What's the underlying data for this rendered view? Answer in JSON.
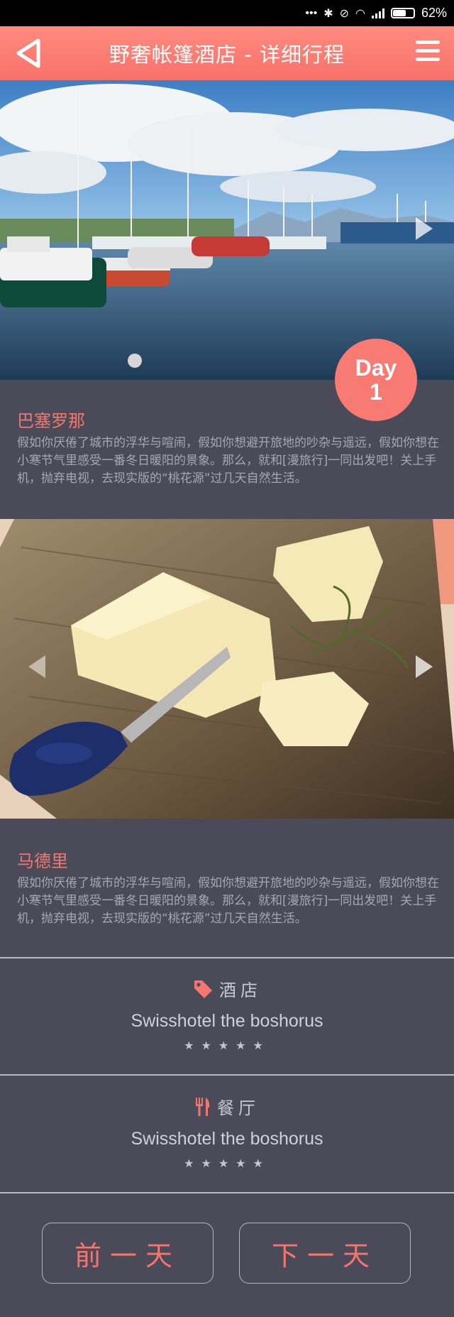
{
  "status_bar": {
    "battery": "62%"
  },
  "header": {
    "title": "野奢帐篷酒店 - 详细行程"
  },
  "day_badge": {
    "label": "Day",
    "number": "1"
  },
  "stops": [
    {
      "city": "巴塞罗那",
      "description": "假如你厌倦了城市的浮华与喧闹，假如你想避开旅地的吵杂与遥远，假如你想在小寒节气里感受一番冬日暖阳的景象。那么，就和[漫旅行]一同出发吧！关上手机，抛弃电视，去现实版的“桃花源”过几天自然生活。"
    },
    {
      "city": "马德里",
      "description": "假如你厌倦了城市的浮华与喧闹，假如你想避开旅地的吵杂与遥远，假如你想在小寒节气里感受一番冬日暖阳的景象。那么，就和[漫旅行]一同出发吧！关上手机，抛弃电视，去现实版的“桃花源”过几天自然生活。"
    }
  ],
  "hotel": {
    "label": "酒店",
    "name": "Swisshotel the boshorus",
    "stars": "★★★★★",
    "icon": "tag-icon"
  },
  "restaurant": {
    "label": "餐厅",
    "name": "Swisshotel the boshorus",
    "stars": "★★★★★",
    "icon": "fork-knife-icon"
  },
  "buttons": {
    "prev": "前一天",
    "next": "下一天"
  },
  "colors": {
    "accent": "#f87a72",
    "background": "#4a4a58"
  }
}
